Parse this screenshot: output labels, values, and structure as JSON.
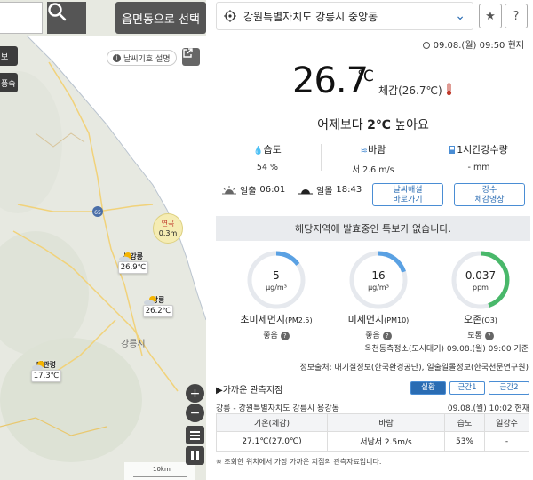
{
  "map": {
    "region_button": "읍면동으로 선택",
    "side_label_1": "보",
    "side_label_2": "풍속",
    "legend_button": "날씨기호 설명",
    "sea_station": {
      "name": "연곡",
      "value": "0.3m"
    },
    "highway_label": "65",
    "city_label": "강릉시",
    "zoom_in": "+",
    "zoom_out": "−",
    "scale_label": "10km",
    "stations": [
      {
        "name": "북강릉",
        "temp": "26.9℃"
      },
      {
        "name": "강릉",
        "temp": "26.2℃"
      },
      {
        "name": "대관령",
        "temp": "17.3℃"
      }
    ]
  },
  "location": {
    "name": "강원특별자치도 강릉시 중앙동"
  },
  "buttons": {
    "favorite": "★",
    "help": "?"
  },
  "current": {
    "obs_time": "09.08.(월) 09:50 현재",
    "temp": "26.7",
    "unit": "℃",
    "feels_like": "체감(26.7℃)",
    "compare_prefix": "어제보다 ",
    "compare_value": "2℃",
    "compare_suffix": " 높아요"
  },
  "stats": [
    {
      "label": "습도",
      "value": "54 %"
    },
    {
      "label": "바람",
      "value": "서 2.6 m/s"
    },
    {
      "label": "1시간강수량",
      "value": "- mm"
    }
  ],
  "sun": {
    "sunrise_label": "일출",
    "sunrise": "06:01",
    "sunset_label": "일몰",
    "sunset": "18:43"
  },
  "links": {
    "commentary": [
      "날씨해설",
      "바로가기"
    ],
    "radar": [
      "강수",
      "체감영상"
    ]
  },
  "notice": "해당지역에 발효중인 특보가 없습니다.",
  "air": [
    {
      "value": "5",
      "unit": "μg/m³",
      "name": "초미세먼지",
      "sub": "(PM2.5)",
      "grade": "좋음",
      "level": 0.15,
      "color": "#5aa1e3"
    },
    {
      "value": "16",
      "unit": "μg/m³",
      "name": "미세먼지",
      "sub": "(PM10)",
      "grade": "좋음",
      "level": 0.2,
      "color": "#5aa1e3"
    },
    {
      "value": "0.037",
      "unit": "ppm",
      "name": "오존",
      "sub": "(O3)",
      "grade": "보통",
      "level": 0.45,
      "color": "#49b86a"
    }
  ],
  "air_station": "옥천동측정소(도시대기) 09.08.(월) 09:00 기준",
  "air_source": "정보출처: 대기질정보(한국환경공단), 일출일몰정보(한국천문연구원)",
  "nearby": {
    "title": "가까운 관측지점",
    "tabs": [
      "실황",
      "근간1",
      "근간2"
    ],
    "location": "강릉 - 강원특별자치도 강릉시 용강동",
    "time": "09.08.(월) 10:02 현재",
    "headers": [
      "기온(체감)",
      "바람",
      "습도",
      "일강수"
    ],
    "row": [
      "27.1℃(27.0℃)",
      "서남서 2.5m/s",
      "53%",
      "-"
    ],
    "footnote": "※ 조회한 위치에서 가장 가까운 지점의 관측자료입니다."
  }
}
